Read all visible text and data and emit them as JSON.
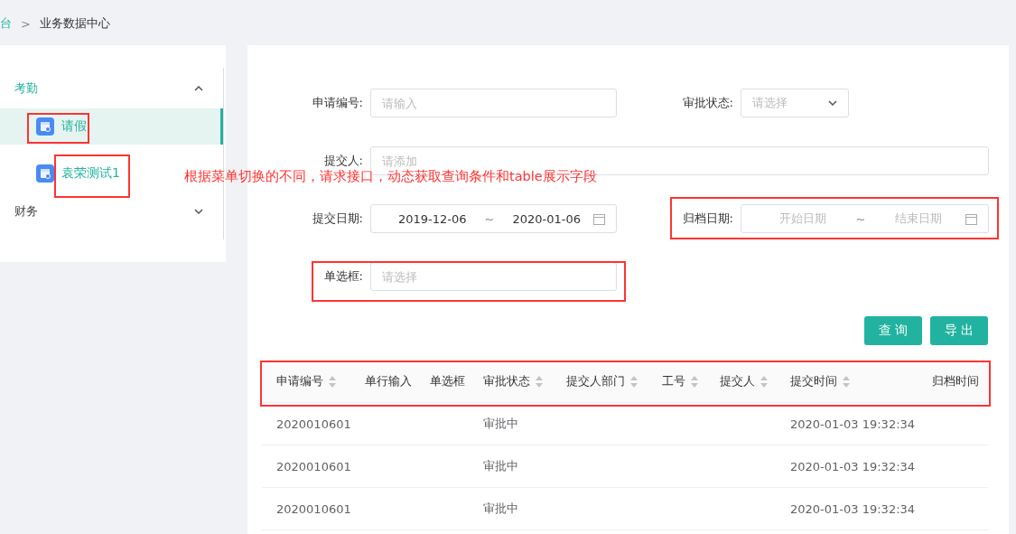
{
  "breadcrumb": [
    {
      "label": "台",
      "link": true
    },
    {
      "label": "业务数据中心",
      "link": false
    }
  ],
  "breadcrumb_separator": ">",
  "sidebar": {
    "groups": [
      {
        "label": "考勤",
        "expanded": true,
        "children": [
          {
            "label": "请假",
            "selected": true
          },
          {
            "label": "袁荣测试1",
            "selected": false
          }
        ]
      },
      {
        "label": "财务",
        "expanded": false
      }
    ]
  },
  "filters": [
    {
      "kind": "input",
      "label": "申请编号:",
      "placeholder": "请输入"
    },
    {
      "kind": "select",
      "label": "审批状态:",
      "placeholder": "请选择"
    },
    {
      "kind": "wide_input",
      "label": "提交人:",
      "placeholder": "请添加"
    },
    {
      "kind": "daterange",
      "label": "提交日期:",
      "start": "2019-12-06",
      "end": "2020-01-06",
      "separator": "~"
    },
    {
      "kind": "daterange",
      "label": "归档日期:",
      "start_placeholder": "开始日期",
      "end_placeholder": "结束日期",
      "separator": "~"
    },
    {
      "kind": "input",
      "label": "单选框:",
      "placeholder": "请选择"
    }
  ],
  "buttons": [
    "查 询",
    "导 出"
  ],
  "table": {
    "columns": [
      {
        "label": "申请编号",
        "sortable": true
      },
      {
        "label": "单行输入",
        "sortable": false
      },
      {
        "label": "单选框",
        "sortable": false
      },
      {
        "label": "审批状态",
        "sortable": true
      },
      {
        "label": "提交人部门",
        "sortable": true
      },
      {
        "label": "工号",
        "sortable": true
      },
      {
        "label": "提交人",
        "sortable": true
      },
      {
        "label": "提交时间",
        "sortable": true
      },
      {
        "label": "归档时间",
        "sortable": false
      }
    ],
    "rows": [
      [
        "2020010601",
        "",
        "",
        "审批中",
        "",
        "",
        "",
        "2020-01-03 19:32:34",
        ""
      ],
      [
        "2020010601",
        "",
        "",
        "审批中",
        "",
        "",
        "",
        "2020-01-03 19:32:34",
        ""
      ],
      [
        "2020010601",
        "",
        "",
        "审批中",
        "",
        "",
        "",
        "2020-01-03 19:32:34",
        ""
      ]
    ]
  },
  "annotation": {
    "text": "根据菜单切换的不同，请求接口，动态获取查询条件和table展示字段"
  }
}
